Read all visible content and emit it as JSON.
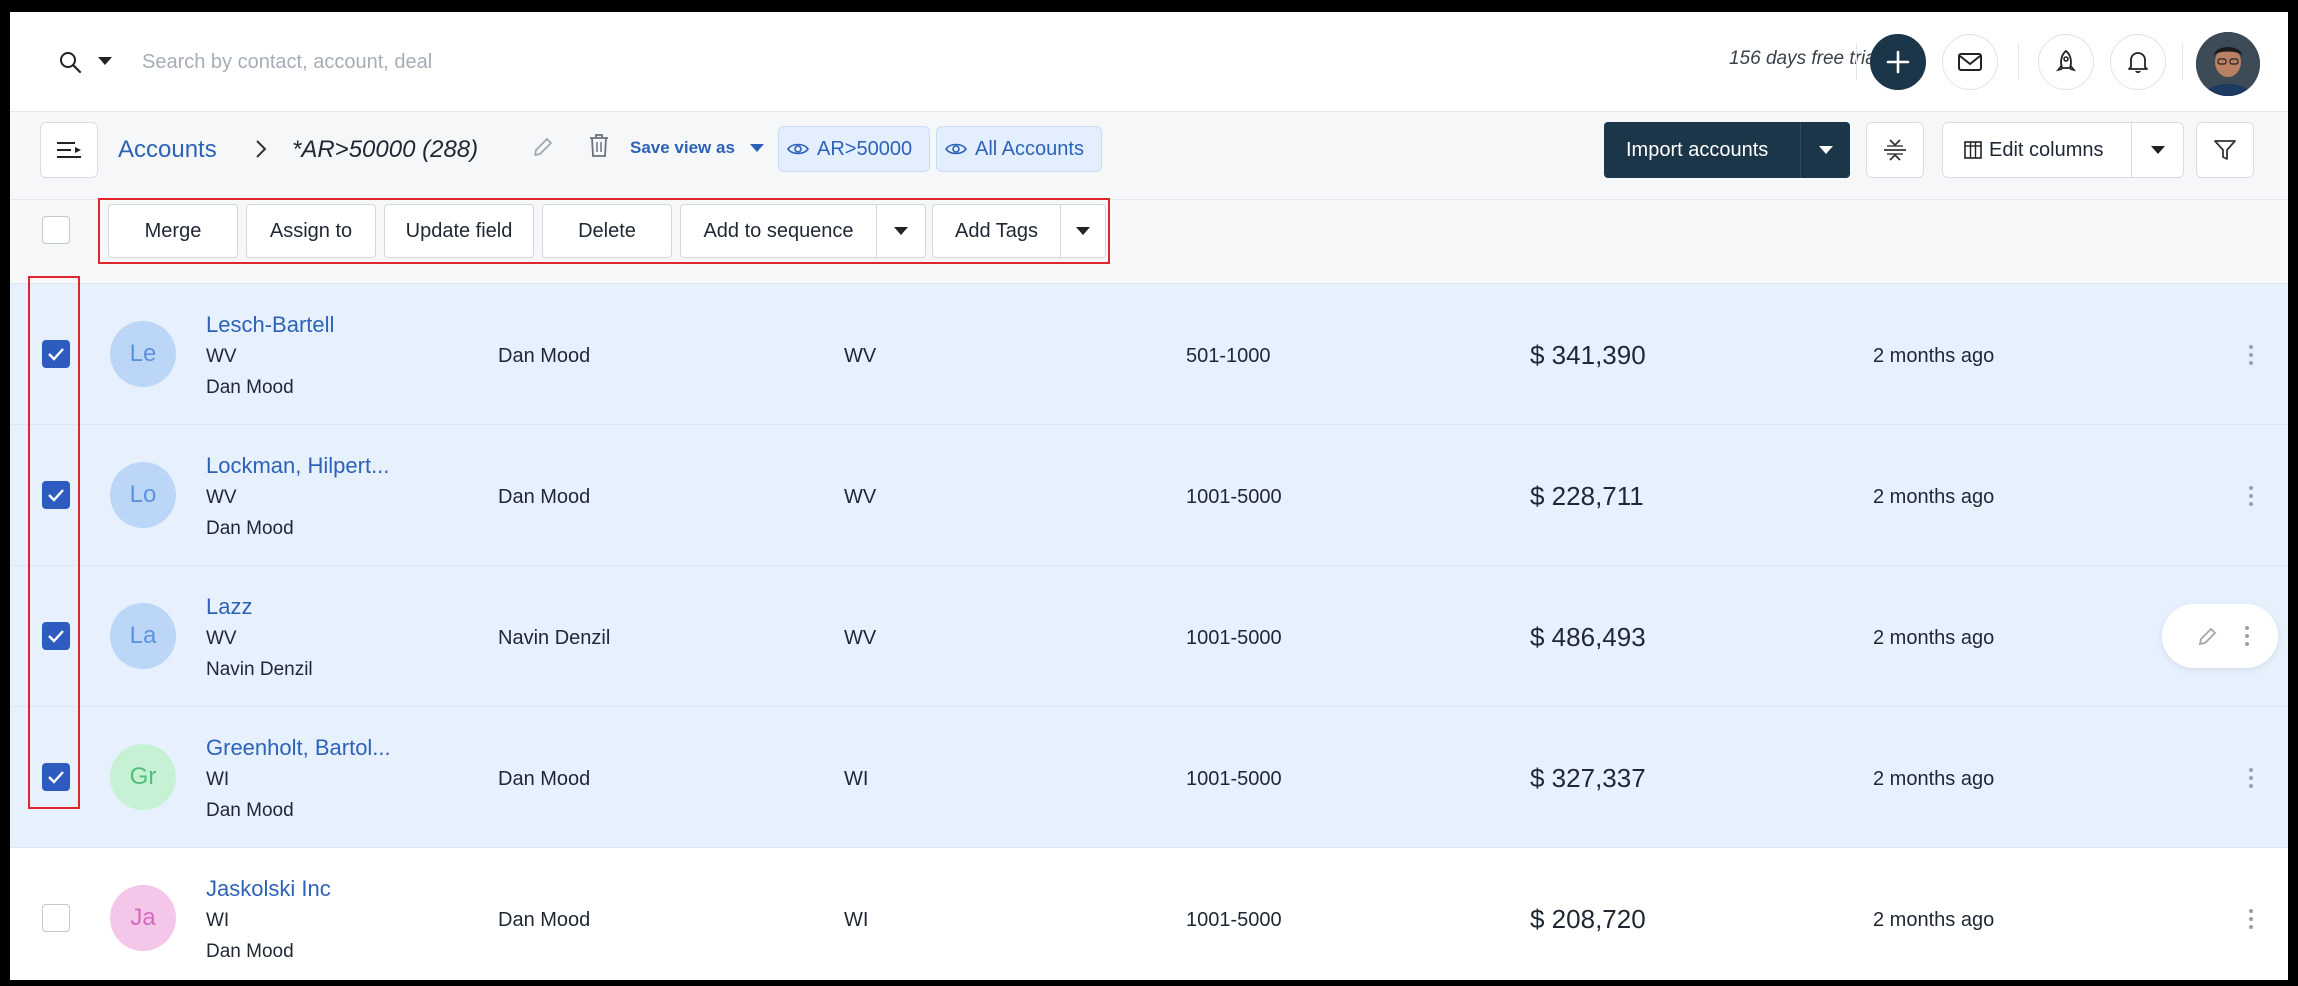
{
  "topbar": {
    "search_placeholder": "Search by contact, account, deal",
    "trial_text": "156 days free trial"
  },
  "viewbar": {
    "breadcrumb_root": "Accounts",
    "view_title": "*AR>50000 (288)",
    "save_view_label": "Save view as",
    "chips": [
      "AR>50000",
      "All Accounts"
    ],
    "import_label": "Import accounts",
    "edit_columns_label": "Edit columns"
  },
  "bulk_actions": {
    "merge": "Merge",
    "assign_to": "Assign to",
    "update_field": "Update field",
    "delete": "Delete",
    "add_to_sequence": "Add to sequence",
    "add_tags": "Add Tags"
  },
  "colors": {
    "primary_dark": "#1b3549",
    "link_blue": "#2d62b8",
    "selected_row": "#e6f1fd",
    "highlight_red": "#e0262b",
    "checkbox_on": "#2d5bbf"
  },
  "rows": [
    {
      "initials": "Le",
      "avatar_bg": "#bcd6f7",
      "avatar_fg": "#5d93de",
      "name": "Lesch-Bartell",
      "state": "WV",
      "owner_sub": "Dan Mood",
      "owner": "Dan Mood",
      "state_col": "WV",
      "size": "501-1000",
      "arr": "$ 341,390",
      "last_activity": "2 months ago",
      "selected": true
    },
    {
      "initials": "Lo",
      "avatar_bg": "#bcd6f7",
      "avatar_fg": "#5d93de",
      "name": "Lockman, Hilpert...",
      "state": "WV",
      "owner_sub": "Dan Mood",
      "owner": "Dan Mood",
      "state_col": "WV",
      "size": "1001-5000",
      "arr": "$ 228,711",
      "last_activity": "2 months ago",
      "selected": true
    },
    {
      "initials": "La",
      "avatar_bg": "#bcd6f7",
      "avatar_fg": "#5d93de",
      "name": "Lazz",
      "state": "WV",
      "owner_sub": "Navin Denzil",
      "owner": "Navin Denzil",
      "state_col": "WV",
      "size": "1001-5000",
      "arr": "$ 486,493",
      "last_activity": "2 months ago",
      "selected": true
    },
    {
      "initials": "Gr",
      "avatar_bg": "#c7f1d5",
      "avatar_fg": "#4fbf78",
      "name": "Greenholt, Bartol...",
      "state": "WI",
      "owner_sub": "Dan Mood",
      "owner": "Dan Mood",
      "state_col": "WI",
      "size": "1001-5000",
      "arr": "$ 327,337",
      "last_activity": "2 months ago",
      "selected": true
    },
    {
      "initials": "Ja",
      "avatar_bg": "#f3c6ea",
      "avatar_fg": "#d46cbd",
      "name": "Jaskolski Inc",
      "state": "WI",
      "owner_sub": "Dan Mood",
      "owner": "Dan Mood",
      "state_col": "WI",
      "size": "1001-5000",
      "arr": "$ 208,720",
      "last_activity": "2 months ago",
      "selected": false
    }
  ]
}
